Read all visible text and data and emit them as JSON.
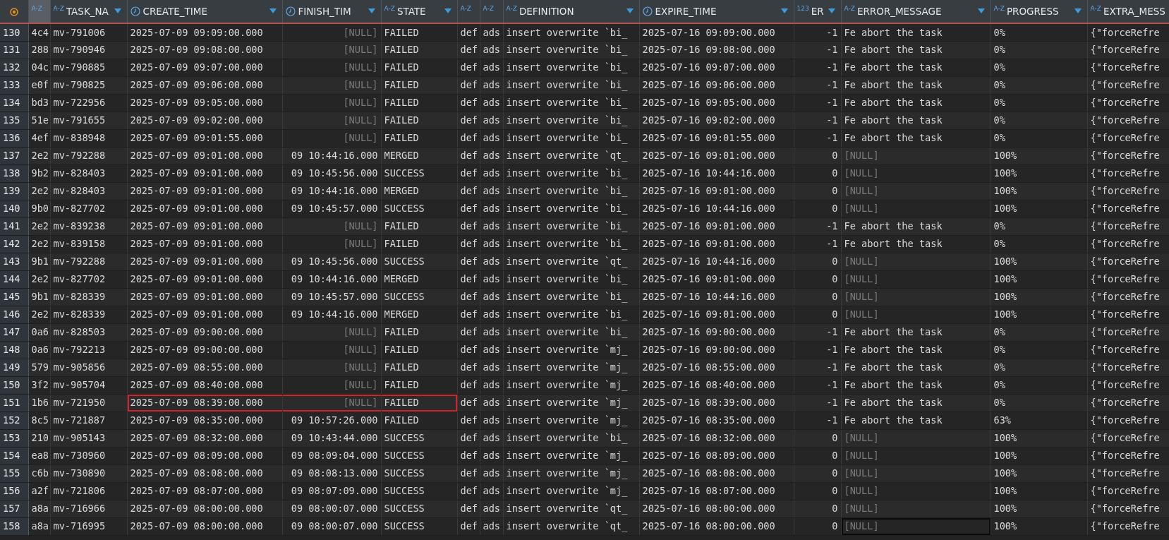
{
  "columns": [
    {
      "kind": "rownum",
      "selected": false,
      "filter": false,
      "right_aligned": false
    },
    {
      "kind": "text",
      "type_label": "A-Z",
      "selected": true,
      "filter": false,
      "right_aligned": false
    },
    {
      "label": "TASK_NA",
      "kind": "text",
      "type_label": "A-Z",
      "selected": false,
      "filter": true,
      "right_aligned": false
    },
    {
      "label": "CREATE_TIME",
      "kind": "time",
      "selected": false,
      "filter": true,
      "right_aligned": false
    },
    {
      "label": "FINISH_TIM",
      "kind": "time",
      "selected": false,
      "filter": true,
      "right_aligned": true
    },
    {
      "label": "STATE",
      "kind": "text",
      "type_label": "A-Z",
      "selected": false,
      "filter": true,
      "right_aligned": false
    },
    {
      "kind": "text",
      "type_label": "A-Z",
      "selected": false,
      "filter": false
    },
    {
      "kind": "text",
      "type_label": "A-Z",
      "selected": false,
      "filter": false
    },
    {
      "label": "DEFINITION",
      "kind": "text",
      "type_label": "A-Z",
      "selected": false,
      "filter": true,
      "right_aligned": false
    },
    {
      "label": "EXPIRE_TIME",
      "kind": "time",
      "selected": false,
      "filter": true,
      "right_aligned": false
    },
    {
      "label": "ER",
      "kind": "number",
      "type_label": "123",
      "selected": false,
      "filter": true,
      "right_aligned": true
    },
    {
      "label": "ERROR_MESSAGE",
      "kind": "text",
      "type_label": "A-Z",
      "selected": false,
      "filter": true,
      "right_aligned": false
    },
    {
      "label": "PROGRESS",
      "kind": "text",
      "type_label": "A-Z",
      "selected": false,
      "filter": true,
      "right_aligned": false
    },
    {
      "label": "EXTRA_MESS",
      "kind": "text",
      "type_label": "A-Z",
      "selected": false,
      "filter": false,
      "right_aligned": false
    }
  ],
  "rows": [
    {
      "highlighted": false,
      "focused": false,
      "cells": [
        "130",
        "4c4",
        "mv-791006",
        "2025-07-09 09:09:00.000",
        {
          "text": "[NULL]",
          "null": true
        },
        "FAILED",
        "def",
        "ads",
        "insert overwrite `bi_",
        "2025-07-16 09:09:00.000",
        "-1",
        "Fe abort the task",
        "0%",
        "{\"forceRefre"
      ]
    },
    {
      "highlighted": false,
      "focused": false,
      "cells": [
        "131",
        "288",
        "mv-790946",
        "2025-07-09 09:08:00.000",
        {
          "text": "[NULL]",
          "null": true
        },
        "FAILED",
        "def",
        "ads",
        "insert overwrite `bi_",
        "2025-07-16 09:08:00.000",
        "-1",
        "Fe abort the task",
        "0%",
        "{\"forceRefre"
      ]
    },
    {
      "highlighted": false,
      "focused": false,
      "cells": [
        "132",
        "04c",
        "mv-790885",
        "2025-07-09 09:07:00.000",
        {
          "text": "[NULL]",
          "null": true
        },
        "FAILED",
        "def",
        "ads",
        "insert overwrite `bi_",
        "2025-07-16 09:07:00.000",
        "-1",
        "Fe abort the task",
        "0%",
        "{\"forceRefre"
      ]
    },
    {
      "highlighted": false,
      "focused": false,
      "cells": [
        "133",
        "e0f",
        "mv-790825",
        "2025-07-09 09:06:00.000",
        {
          "text": "[NULL]",
          "null": true
        },
        "FAILED",
        "def",
        "ads",
        "insert overwrite `bi_",
        "2025-07-16 09:06:00.000",
        "-1",
        "Fe abort the task",
        "0%",
        "{\"forceRefre"
      ]
    },
    {
      "highlighted": false,
      "focused": false,
      "cells": [
        "134",
        "bd3",
        "mv-722956",
        "2025-07-09 09:05:00.000",
        {
          "text": "[NULL]",
          "null": true
        },
        "FAILED",
        "def",
        "ads",
        "insert overwrite `bi_",
        "2025-07-16 09:05:00.000",
        "-1",
        "Fe abort the task",
        "0%",
        "{\"forceRefre"
      ]
    },
    {
      "highlighted": false,
      "focused": false,
      "cells": [
        "135",
        "51e",
        "mv-791655",
        "2025-07-09 09:02:00.000",
        {
          "text": "[NULL]",
          "null": true
        },
        "FAILED",
        "def",
        "ads",
        "insert overwrite `bi_",
        "2025-07-16 09:02:00.000",
        "-1",
        "Fe abort the task",
        "0%",
        "{\"forceRefre"
      ]
    },
    {
      "highlighted": false,
      "focused": false,
      "cells": [
        "136",
        "4ef",
        "mv-838948",
        "2025-07-09 09:01:55.000",
        {
          "text": "[NULL]",
          "null": true
        },
        "FAILED",
        "def",
        "ads",
        "insert overwrite `bi_",
        "2025-07-16 09:01:55.000",
        "-1",
        "Fe abort the task",
        "0%",
        "{\"forceRefre"
      ]
    },
    {
      "highlighted": false,
      "focused": false,
      "cells": [
        "137",
        "2e2",
        "mv-792288",
        "2025-07-09 09:01:00.000",
        "09 10:44:16.000",
        "MERGED",
        "def",
        "ads",
        "insert overwrite `qt_",
        "2025-07-16 09:01:00.000",
        "0",
        {
          "text": "[NULL]",
          "null": true
        },
        "100%",
        "{\"forceRefre"
      ]
    },
    {
      "highlighted": false,
      "focused": false,
      "cells": [
        "138",
        "9b2",
        "mv-828403",
        "2025-07-09 09:01:00.000",
        "09 10:45:56.000",
        "SUCCESS",
        "def",
        "ads",
        "insert overwrite `bi_",
        "2025-07-16 10:44:16.000",
        "0",
        {
          "text": "[NULL]",
          "null": true
        },
        "100%",
        "{\"forceRefre"
      ]
    },
    {
      "highlighted": false,
      "focused": false,
      "cells": [
        "139",
        "2e2",
        "mv-828403",
        "2025-07-09 09:01:00.000",
        "09 10:44:16.000",
        "MERGED",
        "def",
        "ads",
        "insert overwrite `bi_",
        "2025-07-16 09:01:00.000",
        "0",
        {
          "text": "[NULL]",
          "null": true
        },
        "100%",
        "{\"forceRefre"
      ]
    },
    {
      "highlighted": false,
      "focused": false,
      "cells": [
        "140",
        "9b0",
        "mv-827702",
        "2025-07-09 09:01:00.000",
        "09 10:45:57.000",
        "SUCCESS",
        "def",
        "ads",
        "insert overwrite `bi_",
        "2025-07-16 10:44:16.000",
        "0",
        {
          "text": "[NULL]",
          "null": true
        },
        "100%",
        "{\"forceRefre"
      ]
    },
    {
      "highlighted": false,
      "focused": false,
      "cells": [
        "141",
        "2e2",
        "mv-839238",
        "2025-07-09 09:01:00.000",
        {
          "text": "[NULL]",
          "null": true
        },
        "FAILED",
        "def",
        "ads",
        "insert overwrite `bi_",
        "2025-07-16 09:01:00.000",
        "-1",
        "Fe abort the task",
        "0%",
        "{\"forceRefre"
      ]
    },
    {
      "highlighted": false,
      "focused": false,
      "cells": [
        "142",
        "2e2",
        "mv-839158",
        "2025-07-09 09:01:00.000",
        {
          "text": "[NULL]",
          "null": true
        },
        "FAILED",
        "def",
        "ads",
        "insert overwrite `bi_",
        "2025-07-16 09:01:00.000",
        "-1",
        "Fe abort the task",
        "0%",
        "{\"forceRefre"
      ]
    },
    {
      "highlighted": false,
      "focused": false,
      "cells": [
        "143",
        "9b1",
        "mv-792288",
        "2025-07-09 09:01:00.000",
        "09 10:45:56.000",
        "SUCCESS",
        "def",
        "ads",
        "insert overwrite `qt_",
        "2025-07-16 10:44:16.000",
        "0",
        {
          "text": "[NULL]",
          "null": true
        },
        "100%",
        "{\"forceRefre"
      ]
    },
    {
      "highlighted": false,
      "focused": false,
      "cells": [
        "144",
        "2e2",
        "mv-827702",
        "2025-07-09 09:01:00.000",
        "09 10:44:16.000",
        "MERGED",
        "def",
        "ads",
        "insert overwrite `bi_",
        "2025-07-16 09:01:00.000",
        "0",
        {
          "text": "[NULL]",
          "null": true
        },
        "100%",
        "{\"forceRefre"
      ]
    },
    {
      "highlighted": false,
      "focused": false,
      "cells": [
        "145",
        "9b1",
        "mv-828339",
        "2025-07-09 09:01:00.000",
        "09 10:45:57.000",
        "SUCCESS",
        "def",
        "ads",
        "insert overwrite `bi_",
        "2025-07-16 10:44:16.000",
        "0",
        {
          "text": "[NULL]",
          "null": true
        },
        "100%",
        "{\"forceRefre"
      ]
    },
    {
      "highlighted": false,
      "focused": false,
      "cells": [
        "146",
        "2e2",
        "mv-828339",
        "2025-07-09 09:01:00.000",
        "09 10:44:16.000",
        "MERGED",
        "def",
        "ads",
        "insert overwrite `bi_",
        "2025-07-16 09:01:00.000",
        "0",
        {
          "text": "[NULL]",
          "null": true
        },
        "100%",
        "{\"forceRefre"
      ]
    },
    {
      "highlighted": false,
      "focused": false,
      "cells": [
        "147",
        "0a6",
        "mv-828503",
        "2025-07-09 09:00:00.000",
        {
          "text": "[NULL]",
          "null": true
        },
        "FAILED",
        "def",
        "ads",
        "insert overwrite `bi_",
        "2025-07-16 09:00:00.000",
        "-1",
        "Fe abort the task",
        "0%",
        "{\"forceRefre"
      ]
    },
    {
      "highlighted": false,
      "focused": false,
      "cells": [
        "148",
        "0a6",
        "mv-792213",
        "2025-07-09 09:00:00.000",
        {
          "text": "[NULL]",
          "null": true
        },
        "FAILED",
        "def",
        "ads",
        "insert overwrite `mj_",
        "2025-07-16 09:00:00.000",
        "-1",
        "Fe abort the task",
        "0%",
        "{\"forceRefre"
      ]
    },
    {
      "highlighted": false,
      "focused": false,
      "cells": [
        "149",
        "579",
        "mv-905856",
        "2025-07-09 08:55:00.000",
        {
          "text": "[NULL]",
          "null": true
        },
        "FAILED",
        "def",
        "ads",
        "insert overwrite `mj_",
        "2025-07-16 08:55:00.000",
        "-1",
        "Fe abort the task",
        "0%",
        "{\"forceRefre"
      ]
    },
    {
      "highlighted": false,
      "focused": false,
      "cells": [
        "150",
        "3f2",
        "mv-905704",
        "2025-07-09 08:40:00.000",
        {
          "text": "[NULL]",
          "null": true
        },
        "FAILED",
        "def",
        "ads",
        "insert overwrite `mj_",
        "2025-07-16 08:40:00.000",
        "-1",
        "Fe abort the task",
        "0%",
        "{\"forceRefre"
      ]
    },
    {
      "highlighted": true,
      "focused": false,
      "cells": [
        "151",
        "1b6",
        "mv-721950",
        "2025-07-09 08:39:00.000",
        {
          "text": "[NULL]",
          "null": true
        },
        "FAILED",
        "def",
        "ads",
        "insert overwrite `mj_",
        "2025-07-16 08:39:00.000",
        "-1",
        "Fe abort the task",
        "0%",
        "{\"forceRefre"
      ]
    },
    {
      "highlighted": false,
      "focused": false,
      "cells": [
        "152",
        "8c5",
        "mv-721887",
        "2025-07-09 08:35:00.000",
        "09 10:57:26.000",
        "FAILED",
        "def",
        "ads",
        "insert overwrite `mj_",
        "2025-07-16 08:35:00.000",
        "-1",
        "Fe abort the task",
        "63%",
        "{\"forceRefre"
      ]
    },
    {
      "highlighted": false,
      "focused": false,
      "cells": [
        "153",
        "210",
        "mv-905143",
        "2025-07-09 08:32:00.000",
        "09 10:43:44.000",
        "SUCCESS",
        "def",
        "ads",
        "insert overwrite `bi_",
        "2025-07-16 08:32:00.000",
        "0",
        {
          "text": "[NULL]",
          "null": true
        },
        "100%",
        "{\"forceRefre"
      ]
    },
    {
      "highlighted": false,
      "focused": false,
      "cells": [
        "154",
        "ea8",
        "mv-730960",
        "2025-07-09 08:09:00.000",
        "09 08:09:04.000",
        "SUCCESS",
        "def",
        "ads",
        "insert overwrite `mj_",
        "2025-07-16 08:09:00.000",
        "0",
        {
          "text": "[NULL]",
          "null": true
        },
        "100%",
        "{\"forceRefre"
      ]
    },
    {
      "highlighted": false,
      "focused": false,
      "cells": [
        "155",
        "c6b",
        "mv-730890",
        "2025-07-09 08:08:00.000",
        "09 08:08:13.000",
        "SUCCESS",
        "def",
        "ads",
        "insert overwrite `mj_",
        "2025-07-16 08:08:00.000",
        "0",
        {
          "text": "[NULL]",
          "null": true
        },
        "100%",
        "{\"forceRefre"
      ]
    },
    {
      "highlighted": false,
      "focused": false,
      "cells": [
        "156",
        "a2f",
        "mv-721806",
        "2025-07-09 08:07:00.000",
        "09 08:07:09.000",
        "SUCCESS",
        "def",
        "ads",
        "insert overwrite `mj_",
        "2025-07-16 08:07:00.000",
        "0",
        {
          "text": "[NULL]",
          "null": true
        },
        "100%",
        "{\"forceRefre"
      ]
    },
    {
      "highlighted": false,
      "focused": false,
      "cells": [
        "157",
        "a8a",
        "mv-716966",
        "2025-07-09 08:00:00.000",
        "09 08:00:07.000",
        "SUCCESS",
        "def",
        "ads",
        "insert overwrite `qt_",
        "2025-07-16 08:00:00.000",
        "0",
        {
          "text": "[NULL]",
          "null": true
        },
        "100%",
        "{\"forceRefre"
      ]
    },
    {
      "highlighted": false,
      "focused": true,
      "cells": [
        "158",
        "a8a",
        "mv-716995",
        "2025-07-09 08:00:00.000",
        "09 08:00:07.000",
        "SUCCESS",
        "def",
        "ads",
        "insert overwrite `qt_",
        "2025-07-16 08:00:00.000",
        "0",
        {
          "text": "[NULL]",
          "null": true
        },
        "100%",
        "{\"forceRefre"
      ]
    }
  ]
}
